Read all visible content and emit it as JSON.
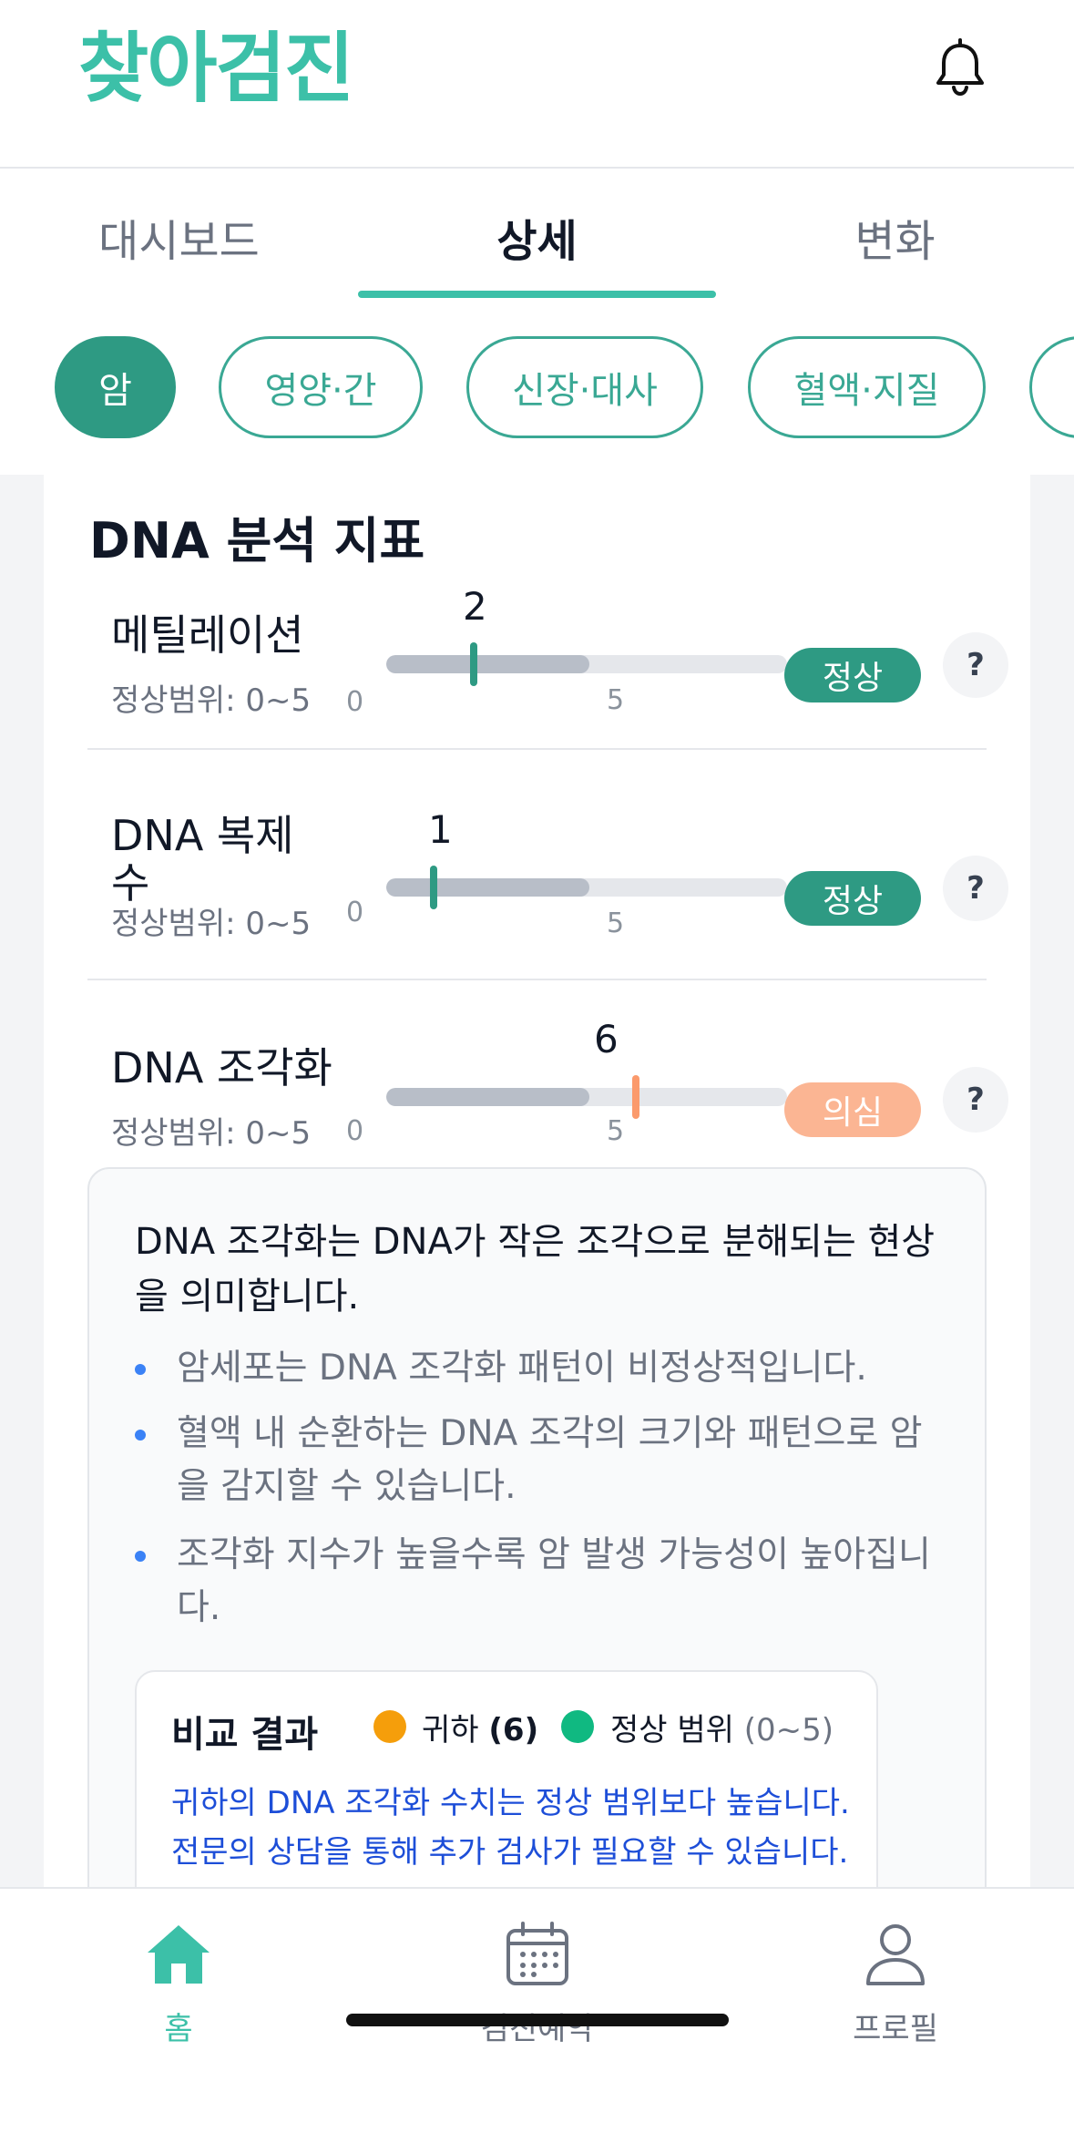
{
  "app": {
    "logo": "찾아검진"
  },
  "tabs": [
    {
      "label": "대시보드",
      "active": false
    },
    {
      "label": "상세",
      "active": true
    },
    {
      "label": "변화",
      "active": false
    }
  ],
  "chips": [
    {
      "label": "암",
      "active": true
    },
    {
      "label": "영양·간",
      "active": false
    },
    {
      "label": "신장·대사",
      "active": false
    },
    {
      "label": "혈액·지질",
      "active": false
    }
  ],
  "section": {
    "title": "DNA 분석 지표"
  },
  "indicators": [
    {
      "name": "메틸레이션",
      "range": "정상범위: 0~5",
      "value": "2",
      "tick_min": "0",
      "tick_mid": "5",
      "status": "정상",
      "status_type": "ok"
    },
    {
      "name": "DNA 복제 수",
      "range": "정상범위: 0~5",
      "value": "1",
      "tick_min": "0",
      "tick_mid": "5",
      "status": "정상",
      "status_type": "ok"
    },
    {
      "name": "DNA 조각화",
      "range": "정상범위: 0~5",
      "value": "6",
      "tick_min": "0",
      "tick_mid": "5",
      "status": "의심",
      "status_type": "warn"
    }
  ],
  "help_label": "?",
  "info": {
    "lead": "DNA 조각화는 DNA가 작은 조각으로 분해되는 현상을 의미합니다.",
    "bullets": [
      "암세포는 DNA 조각화 패턴이 비정상적입니다.",
      "혈액 내 순환하는 DNA 조각의 크기와 패턴으로 암을 감지할 수 있습니다.",
      "조각화 지수가 높을수록 암 발생 가능성이 높아집니다."
    ]
  },
  "compare": {
    "title": "비교 결과",
    "you_label": "귀하",
    "you_value": "(6)",
    "normal_label": "정상 범위",
    "normal_value": "(0~5)",
    "message_line1": "귀하의 DNA 조각화 수치는 정상 범위보다 높습니다.",
    "message_line2": "전문의 상담을 통해 추가 검사가 필요할 수 있습니다."
  },
  "bottom_nav": [
    {
      "label": "홈",
      "icon": "home-icon",
      "active": true
    },
    {
      "label": "검진예약",
      "icon": "calendar-icon",
      "active": false
    },
    {
      "label": "프로필",
      "icon": "user-icon",
      "active": false
    }
  ],
  "colors": {
    "brand": "#3cc0a8",
    "normal_badge": "#2e9a83",
    "warn_badge": "#fbb593",
    "user_dot": "#f59e0b",
    "normal_dot": "#10b981",
    "message": "#1d4ed8"
  }
}
